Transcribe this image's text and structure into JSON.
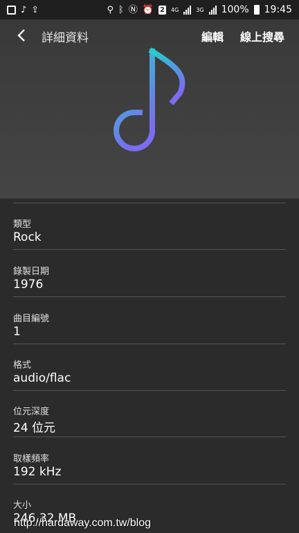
{
  "status_bar": {
    "battery": "100%",
    "time": "19:45",
    "network_4g": "4G",
    "network_3g": "3G",
    "badge": "2"
  },
  "header": {
    "title": "詳細資料",
    "edit_label": "編輯",
    "search_label": "線上搜尋"
  },
  "colors": {
    "note_gradient_top": "#21d1c9",
    "note_gradient_bottom": "#7b6cf2"
  },
  "details": [
    {
      "label": "類型",
      "value": "Rock"
    },
    {
      "label": "錄製日期",
      "value": "1976"
    },
    {
      "label": "曲目編號",
      "value": "1"
    },
    {
      "label": "格式",
      "value": "audio/flac"
    },
    {
      "label": "位元深度",
      "value": "24 位元"
    },
    {
      "label": "取樣頻率",
      "value": "192 kHz"
    },
    {
      "label": "大小",
      "value": "246.32 MB"
    }
  ],
  "watermark": "http://hardaway.com.tw/blog"
}
